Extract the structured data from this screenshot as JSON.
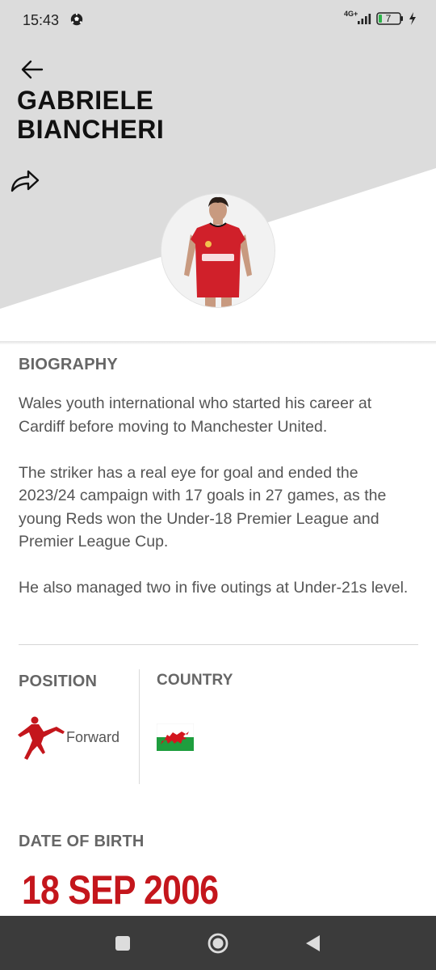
{
  "status_bar": {
    "time": "15:43",
    "network_label": "4G+",
    "battery_level": "7",
    "icons": [
      "soccer-ball-icon",
      "signal-icon",
      "battery-icon",
      "charging-bolt-icon"
    ]
  },
  "header": {
    "player_name": "GABRIELE BIANCHERI",
    "back_icon": "arrow-left-icon",
    "share_icon": "share-icon"
  },
  "biography": {
    "title": "BIOGRAPHY",
    "paragraphs": [
      "Wales youth international who started his career at Cardiff before moving to Manchester United.",
      "The striker has a real eye for goal and ended the 2023/24 campaign with 17 goals in 27 games, as the young Reds won the Under-18 Premier League and Premier League Cup.",
      "He also managed two in five outings at Under-21s level."
    ]
  },
  "position": {
    "title": "POSITION",
    "value": "Forward",
    "icon": "footballer-kicking-icon"
  },
  "country": {
    "title": "COUNTRY",
    "flag": "wales-flag-icon"
  },
  "date_of_birth": {
    "title": "DATE OF BIRTH",
    "value": "18 SEP 2006"
  },
  "nav": {
    "buttons": [
      "recents-icon",
      "home-icon",
      "back-triangle-icon"
    ]
  },
  "colors": {
    "accent_red": "#c4161c",
    "header_grey": "#dcdcdc",
    "nav_bar": "#3b3b3b"
  }
}
